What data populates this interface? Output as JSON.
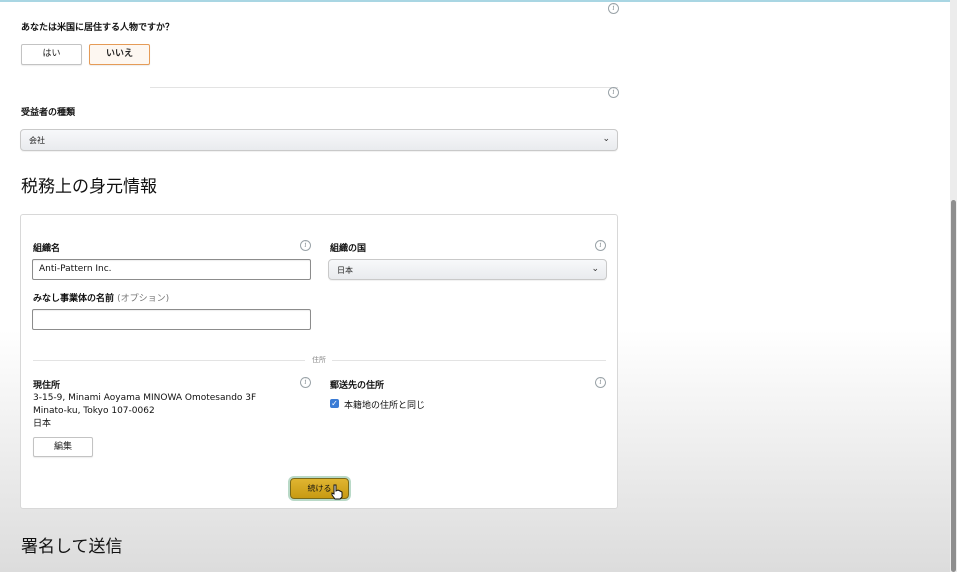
{
  "question": {
    "label": "あなたは米国に居住する人物ですか？",
    "options": [
      "はい",
      "いいえ"
    ],
    "selected": "いいえ"
  },
  "beneficiary": {
    "label": "受益者の種類",
    "value": "会社"
  },
  "tax_section": {
    "title": "税務上の身元情報",
    "org_name_label": "組織名",
    "org_name_value": "Anti-Pattern Inc.",
    "org_country_label": "組織の国",
    "org_country_value": "日本",
    "dba_label": "みなし事業体の名前",
    "dba_optional": "(オプション)",
    "dba_value": "",
    "address_divider": "住所",
    "current_address_label": "現住所",
    "address_line1": "3-15-9, Minami Aoyama MINOWA Omotesando 3F",
    "address_line2": "Minato-ku, Tokyo 107-0062",
    "address_line3": "日本",
    "edit_button": "編集",
    "mailing_address_label": "郵送先の住所",
    "same_as_checkbox": "本籍地の住所と同じ",
    "same_as_checked": true,
    "continue_button": "続ける"
  },
  "sign_section": {
    "title": "署名して送信"
  },
  "icons": {
    "info": "i"
  },
  "colors": {
    "selected_border": "#e59b57",
    "continue_button": "#d4a81f",
    "checkbox": "#3a7bd5"
  }
}
